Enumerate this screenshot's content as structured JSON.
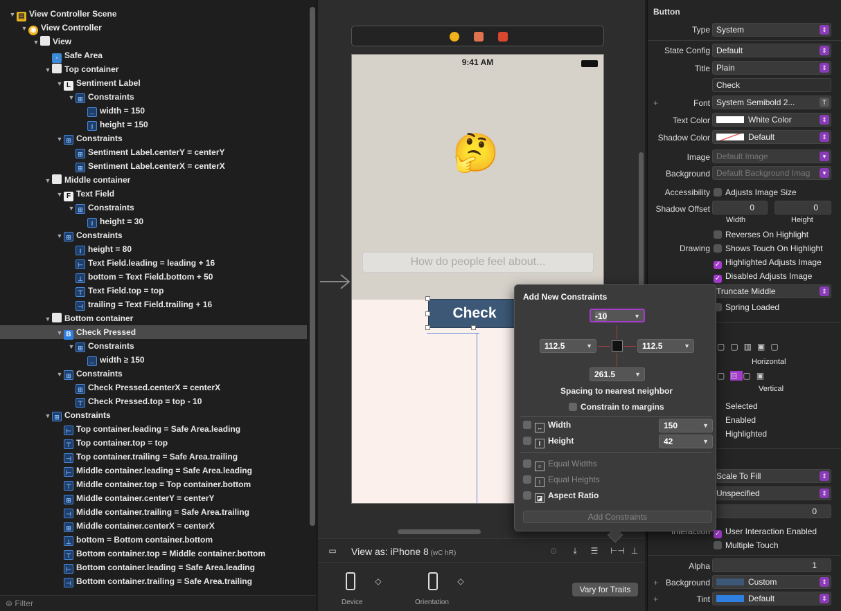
{
  "outline": {
    "rows": [
      {
        "indent": 0,
        "tri": "▼",
        "icon": "scene",
        "glyph": "▤",
        "label": "View Controller Scene"
      },
      {
        "indent": 1,
        "tri": "▼",
        "icon": "vc",
        "glyph": "◉",
        "label": "View Controller"
      },
      {
        "indent": 2,
        "tri": "▼",
        "icon": "view",
        "glyph": "",
        "label": "View"
      },
      {
        "indent": 3,
        "tri": "",
        "icon": "safe",
        "glyph": "▫",
        "label": "Safe Area"
      },
      {
        "indent": 3,
        "tri": "▼",
        "icon": "view",
        "glyph": "",
        "label": "Top container"
      },
      {
        "indent": 4,
        "tri": "▼",
        "icon": "lbl",
        "glyph": "L",
        "label": "Sentiment Label"
      },
      {
        "indent": 5,
        "tri": "▼",
        "icon": "cons",
        "glyph": "⊞",
        "label": "Constraints"
      },
      {
        "indent": 6,
        "tri": "",
        "icon": "cons",
        "glyph": "↔",
        "label": "width = 150"
      },
      {
        "indent": 6,
        "tri": "",
        "icon": "cons",
        "glyph": "I",
        "label": "height = 150"
      },
      {
        "indent": 4,
        "tri": "▼",
        "icon": "cons",
        "glyph": "⊞",
        "label": "Constraints"
      },
      {
        "indent": 5,
        "tri": "",
        "icon": "cons",
        "glyph": "⊞",
        "label": "Sentiment Label.centerY = centerY"
      },
      {
        "indent": 5,
        "tri": "",
        "icon": "cons",
        "glyph": "⊞",
        "label": "Sentiment Label.centerX = centerX"
      },
      {
        "indent": 3,
        "tri": "▼",
        "icon": "view",
        "glyph": "",
        "label": "Middle container"
      },
      {
        "indent": 4,
        "tri": "▼",
        "icon": "lbl",
        "glyph": "F",
        "label": "Text Field"
      },
      {
        "indent": 5,
        "tri": "▼",
        "icon": "cons",
        "glyph": "⊞",
        "label": "Constraints"
      },
      {
        "indent": 6,
        "tri": "",
        "icon": "cons",
        "glyph": "I",
        "label": "height = 30"
      },
      {
        "indent": 4,
        "tri": "▼",
        "icon": "cons",
        "glyph": "⊞",
        "label": "Constraints"
      },
      {
        "indent": 5,
        "tri": "",
        "icon": "cons",
        "glyph": "I",
        "label": "height = 80"
      },
      {
        "indent": 5,
        "tri": "",
        "icon": "cons",
        "glyph": "⊢",
        "label": "Text Field.leading = leading + 16"
      },
      {
        "indent": 5,
        "tri": "",
        "icon": "cons",
        "glyph": "⊥",
        "label": "bottom = Text Field.bottom + 50"
      },
      {
        "indent": 5,
        "tri": "",
        "icon": "cons",
        "glyph": "⊤",
        "label": "Text Field.top = top"
      },
      {
        "indent": 5,
        "tri": "",
        "icon": "cons",
        "glyph": "⊣",
        "label": "trailing = Text Field.trailing + 16"
      },
      {
        "indent": 3,
        "tri": "▼",
        "icon": "view",
        "glyph": "",
        "label": "Bottom container"
      },
      {
        "indent": 4,
        "tri": "▼",
        "icon": "btn",
        "glyph": "B",
        "label": "Check Pressed",
        "selected": true
      },
      {
        "indent": 5,
        "tri": "▼",
        "icon": "cons",
        "glyph": "⊞",
        "label": "Constraints"
      },
      {
        "indent": 6,
        "tri": "",
        "icon": "cons",
        "glyph": "↔",
        "label": "width ≥ 150"
      },
      {
        "indent": 4,
        "tri": "▼",
        "icon": "cons",
        "glyph": "⊞",
        "label": "Constraints"
      },
      {
        "indent": 5,
        "tri": "",
        "icon": "cons",
        "glyph": "⊞",
        "label": "Check Pressed.centerX = centerX"
      },
      {
        "indent": 5,
        "tri": "",
        "icon": "cons",
        "glyph": "⊤",
        "label": "Check Pressed.top = top - 10"
      },
      {
        "indent": 3,
        "tri": "▼",
        "icon": "cons",
        "glyph": "⊞",
        "label": "Constraints"
      },
      {
        "indent": 4,
        "tri": "",
        "icon": "cons",
        "glyph": "⊢",
        "label": "Top container.leading = Safe Area.leading"
      },
      {
        "indent": 4,
        "tri": "",
        "icon": "cons",
        "glyph": "⊤",
        "label": "Top container.top = top"
      },
      {
        "indent": 4,
        "tri": "",
        "icon": "cons",
        "glyph": "⊣",
        "label": "Top container.trailing = Safe Area.trailing"
      },
      {
        "indent": 4,
        "tri": "",
        "icon": "cons",
        "glyph": "⊢",
        "label": "Middle container.leading = Safe Area.leading"
      },
      {
        "indent": 4,
        "tri": "",
        "icon": "cons",
        "glyph": "⊤",
        "label": "Middle container.top = Top container.bottom"
      },
      {
        "indent": 4,
        "tri": "",
        "icon": "cons",
        "glyph": "⊞",
        "label": "Middle container.centerY = centerY"
      },
      {
        "indent": 4,
        "tri": "",
        "icon": "cons",
        "glyph": "⊣",
        "label": "Middle container.trailing = Safe Area.trailing"
      },
      {
        "indent": 4,
        "tri": "",
        "icon": "cons",
        "glyph": "⊞",
        "label": "Middle container.centerX = centerX"
      },
      {
        "indent": 4,
        "tri": "",
        "icon": "cons",
        "glyph": "⊥",
        "label": "bottom = Bottom container.bottom"
      },
      {
        "indent": 4,
        "tri": "",
        "icon": "cons",
        "glyph": "⊤",
        "label": "Bottom container.top = Middle container.bottom"
      },
      {
        "indent": 4,
        "tri": "",
        "icon": "cons",
        "glyph": "⊢",
        "label": "Bottom container.leading = Safe Area.leading"
      },
      {
        "indent": 4,
        "tri": "",
        "icon": "cons",
        "glyph": "⊣",
        "label": "Bottom container.trailing = Safe Area.trailing"
      }
    ],
    "filter_placeholder": "Filter"
  },
  "canvas": {
    "status_time": "9:41 AM",
    "emoji": "🤔",
    "textfield_placeholder": "How do people feel about...",
    "button_title": "Check",
    "view_as": "View as: iPhone 8",
    "view_as_traits": " (wC hR)",
    "device_label": "Device",
    "orientation_label": "Orientation",
    "vary_button": "Vary for Traits"
  },
  "popover": {
    "title": "Add New Constraints",
    "top": "-10",
    "left": "112.5",
    "right": "112.5",
    "bottom": "261.5",
    "spacing_label": "Spacing to nearest neighbor",
    "constrain_margins": "Constrain to margins",
    "width_label": "Width",
    "width_value": "150",
    "height_label": "Height",
    "height_value": "42",
    "equal_widths": "Equal Widths",
    "equal_heights": "Equal Heights",
    "aspect_ratio": "Aspect Ratio",
    "add_button": "Add Constraints"
  },
  "inspector": {
    "section_title": "Button",
    "type_label": "Type",
    "type_value": "System",
    "state_label": "State Config",
    "state_value": "Default",
    "title_label": "Title",
    "title_value": "Plain",
    "title_text": "Check",
    "font_label": "Font",
    "font_value": "System Semibold 2...",
    "textcolor_label": "Text Color",
    "textcolor_value": "White Color",
    "shadowcolor_label": "Shadow Color",
    "shadowcolor_value": "Default",
    "image_label": "Image",
    "image_value": "Default Image",
    "background_label": "Background",
    "background_value": "Default Background Imag",
    "accessibility_label": "Accessibility",
    "adjusts_image_size": "Adjusts Image Size",
    "shadow_offset_label": "Shadow Offset",
    "shadow_w": "0",
    "shadow_h": "0",
    "width_cap": "Width",
    "height_cap": "Height",
    "reverses": "Reverses On Highlight",
    "drawing_label": "Drawing",
    "shows_touch": "Shows Touch On Highlight",
    "highlighted_adjusts": "Highlighted Adjusts Image",
    "disabled_adjusts": "Disabled Adjusts Image",
    "line_break": "Truncate Middle",
    "spring_loaded": "Spring Loaded",
    "horizontal_label": "Horizontal",
    "vertical_label": "Vertical",
    "selected": "Selected",
    "enabled": "Enabled",
    "highlighted": "Highlighted",
    "content_mode": "Scale To Fill",
    "semantic": "Unspecified",
    "tag_value": "0",
    "interaction_label": "Interaction",
    "user_interaction": "User Interaction Enabled",
    "multiple_touch": "Multiple Touch",
    "alpha_label": "Alpha",
    "alpha_value": "1",
    "bg_label": "Background",
    "bg_value": "Custom",
    "tint_label": "Tint",
    "tint_value": "Default"
  },
  "colors": {
    "accent": "#a33ccb",
    "selection": "#4a4a4a",
    "button_fill": "#3c5876",
    "tint_swatch": "#2f7fe0"
  }
}
